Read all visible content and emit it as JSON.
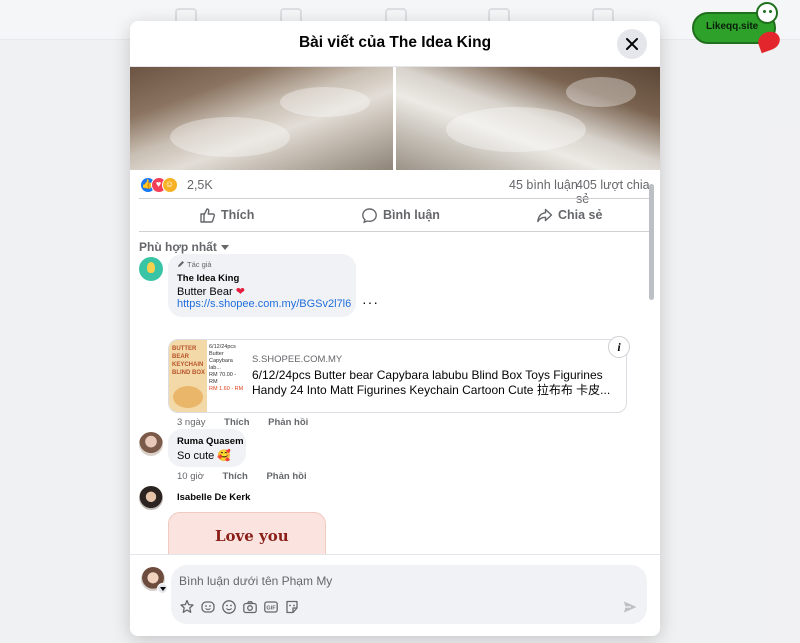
{
  "modal": {
    "title": "Bài viết của The Idea King",
    "close_icon": "close-icon"
  },
  "stats": {
    "reactions": [
      "like",
      "love",
      "care"
    ],
    "reaction_count": "2,5K",
    "comments": "45 bình luận",
    "shares": "405 lượt chia sẻ"
  },
  "actions": {
    "like": "Thích",
    "comment": "Bình luận",
    "share": "Chia sẻ"
  },
  "sort": {
    "label": "Phù hợp nhất"
  },
  "comments": [
    {
      "author_tag": "Tác giả",
      "name": "The Idea King",
      "text": "Butter Bear",
      "emoji": "❤",
      "link": "https://s.shopee.com.my/BGSv2l7l6",
      "link_card": {
        "thumb_title": "BUTTER BEAR KEYCHAIN BLIND BOX",
        "thumb_desc": "6/12/24pcs Butter Capybara lab...",
        "thumb_price_1": "RM 70.00 - RM",
        "thumb_price_2": "RM 1.60 - RM",
        "domain": "S.SHOPEE.COM.MY",
        "title": "6/12/24pcs Butter bear Capybara labubu Blind Box Toys Figurines Handy 24 Into Matt Figurines Keychain Cartoon Cute 拉布布 卡皮..."
      },
      "time": "3 ngày",
      "like": "Thích",
      "reply": "Phản hồi"
    },
    {
      "name": "Ruma Quasem",
      "text": "So cute",
      "emoji": "🥰",
      "time": "10 giờ",
      "like": "Thích",
      "reply": "Phản hồi"
    },
    {
      "name": "Isabelle De Kerk",
      "sticker_text": "Love you"
    }
  ],
  "composer": {
    "placeholder": "Bình luận dưới tên Phạm My",
    "tools": [
      "avatar-sticker-icon",
      "smile-icon",
      "emoji-icon",
      "camera-icon",
      "gif-icon",
      "sticker-icon"
    ],
    "send_icon": "send-icon"
  },
  "watermark": {
    "text": "Likeqq.site"
  },
  "colors": {
    "link": "#216fdb",
    "like": "#1877f2",
    "love": "#f33e58",
    "care": "#f7b125",
    "muted": "#65676b"
  }
}
